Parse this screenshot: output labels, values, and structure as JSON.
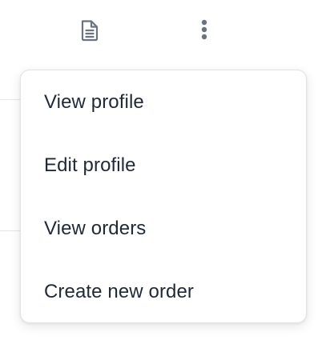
{
  "toolbar": {
    "document_icon": "document-icon",
    "more_icon": "more-vertical-icon",
    "icon_color": "#6b7280"
  },
  "menu": {
    "items": [
      {
        "label": "View profile"
      },
      {
        "label": "Edit profile"
      },
      {
        "label": "View orders"
      },
      {
        "label": "Create new order"
      }
    ]
  },
  "colors": {
    "menu_text": "#1f2937",
    "menu_border": "#e2e4e8",
    "background": "#ffffff"
  }
}
